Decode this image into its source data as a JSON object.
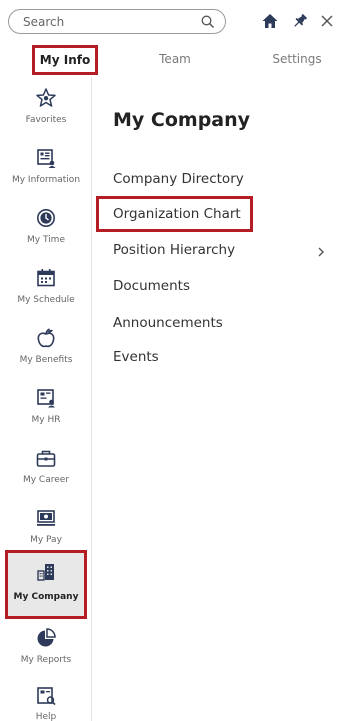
{
  "search": {
    "placeholder": "Search",
    "value": ""
  },
  "tabs": [
    {
      "label": "My Info",
      "active": true
    },
    {
      "label": "Team",
      "active": false
    },
    {
      "label": "Settings",
      "active": false
    }
  ],
  "sidebar": {
    "items": [
      {
        "label": "Favorites",
        "icon": "star-icon"
      },
      {
        "label": "My Information",
        "icon": "id-card-icon"
      },
      {
        "label": "My Time",
        "icon": "clock-icon"
      },
      {
        "label": "My Schedule",
        "icon": "calendar-icon"
      },
      {
        "label": "My Benefits",
        "icon": "apple-icon"
      },
      {
        "label": "My HR",
        "icon": "hr-board-icon"
      },
      {
        "label": "My Career",
        "icon": "briefcase-icon"
      },
      {
        "label": "My Pay",
        "icon": "monitor-pay-icon"
      },
      {
        "label": "My Company",
        "icon": "buildings-icon",
        "active": true
      },
      {
        "label": "My Reports",
        "icon": "pie-chart-icon"
      },
      {
        "label": "Help",
        "icon": "help-book-icon"
      }
    ]
  },
  "main": {
    "title": "My Company",
    "items": [
      {
        "label": "Company Directory"
      },
      {
        "label": "Organization Chart",
        "highlighted": true
      },
      {
        "label": "Position Hierarchy",
        "has_submenu": true
      },
      {
        "label": "Documents"
      },
      {
        "label": "Announcements"
      },
      {
        "label": "Events"
      }
    ]
  },
  "colors": {
    "highlight": "#b51d24",
    "icon": "#2e3a59",
    "text": "#333333"
  }
}
